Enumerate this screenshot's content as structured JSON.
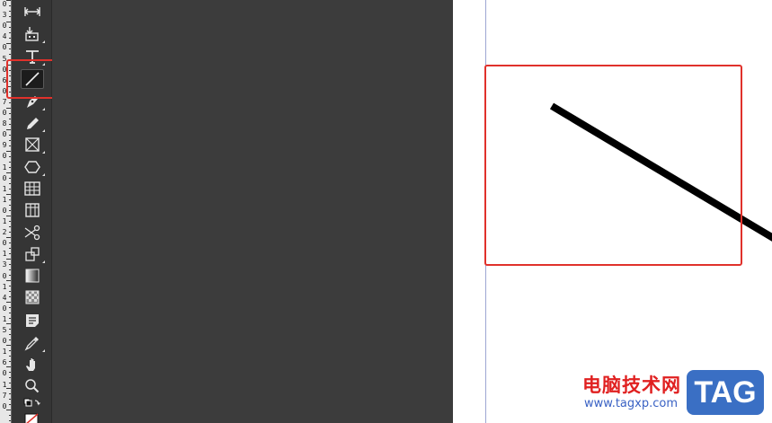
{
  "ruler": {
    "digits": [
      "0",
      "3",
      "0",
      "4",
      "0",
      "5",
      "0",
      "6",
      "0",
      "7",
      "0",
      "8",
      "0",
      "9",
      "0",
      "1",
      "0",
      "1",
      "1",
      "0",
      "1",
      "2",
      "0",
      "1",
      "3",
      "0",
      "1",
      "4",
      "0",
      "1",
      "5",
      "0",
      "1",
      "6",
      "0",
      "1",
      "7",
      "0"
    ]
  },
  "toolbar": {
    "tools": [
      {
        "name": "gap-tool",
        "icon": "gap-icon"
      },
      {
        "name": "content-collector-tool",
        "icon": "content-collector-icon"
      },
      {
        "name": "type-tool",
        "icon": "type-icon"
      },
      {
        "name": "line-tool",
        "icon": "line-icon",
        "active": true
      },
      {
        "name": "pen-tool",
        "icon": "pen-icon"
      },
      {
        "name": "pencil-tool",
        "icon": "pencil-icon"
      },
      {
        "name": "rectangle-frame-tool",
        "icon": "rectangle-frame-icon"
      },
      {
        "name": "polygon-tool",
        "icon": "polygon-icon"
      },
      {
        "name": "table-tool",
        "icon": "table-icon"
      },
      {
        "name": "column-grid-tool",
        "icon": "column-grid-icon"
      },
      {
        "name": "scissors-tool",
        "icon": "scissors-icon"
      },
      {
        "name": "free-transform-tool",
        "icon": "free-transform-icon"
      },
      {
        "name": "gradient-swatch-tool",
        "icon": "gradient-icon"
      },
      {
        "name": "gradient-feather-tool",
        "icon": "gradient-feather-icon"
      },
      {
        "name": "note-tool",
        "icon": "note-icon"
      },
      {
        "name": "eyedropper-tool",
        "icon": "eyedropper-icon"
      },
      {
        "name": "hand-tool",
        "icon": "hand-icon"
      },
      {
        "name": "zoom-tool",
        "icon": "zoom-icon"
      },
      {
        "name": "fill-stroke-swatches",
        "icon": "default-fill-stroke-icon"
      }
    ]
  },
  "colors": {
    "highlight": "#e0312b",
    "stroke": "#000000",
    "workspace": "#3c3c3c",
    "page": "#ffffff"
  },
  "watermark": {
    "site_name": "电脑技术网",
    "url": "www.tagxp.com",
    "tag": "TAG"
  }
}
